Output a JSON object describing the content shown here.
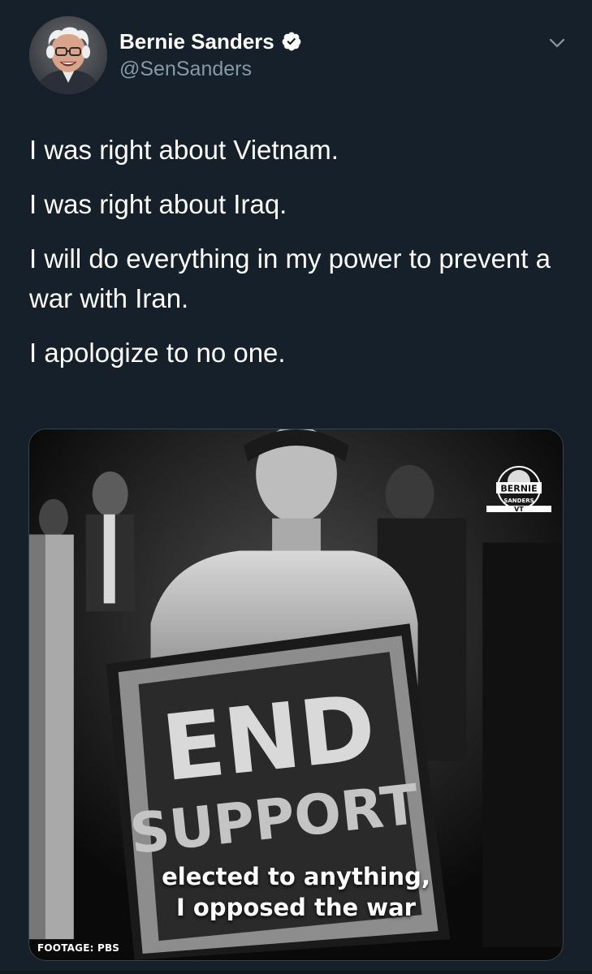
{
  "user": {
    "display_name": "Bernie Sanders",
    "handle": "@SenSanders",
    "verified": true
  },
  "tweet": {
    "paragraphs": [
      "I was right about Vietnam.",
      "I was right about Iraq.",
      "I will do everything in my power to prevent a war with Iran.",
      "I apologize to no one."
    ]
  },
  "media": {
    "caption_lines": [
      "elected to anything,",
      "I opposed the war"
    ],
    "footage_credit": "FOOTAGE: PBS",
    "sign_text": [
      "END",
      "SUPPORT"
    ],
    "logo_text": [
      "BERNIE",
      "SANDERS",
      "VT"
    ]
  },
  "icons": {
    "verified": "verified-badge-icon",
    "menu": "chevron-down-icon"
  },
  "colors": {
    "background": "#15202b",
    "secondary_text": "#8899a6",
    "verified": "#ffffff"
  }
}
